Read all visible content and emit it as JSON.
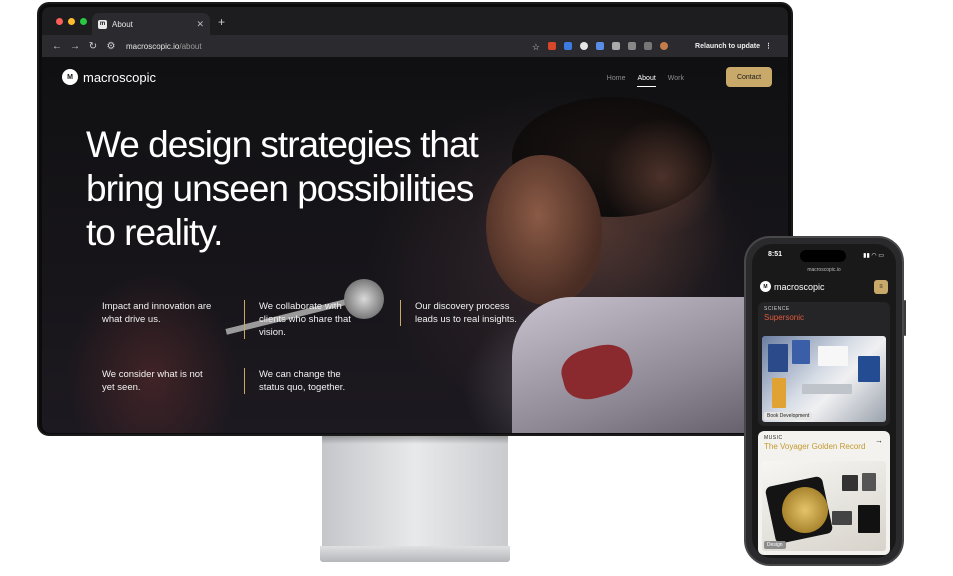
{
  "browser": {
    "tab_title": "About",
    "tab_favicon": "m",
    "url_host": "macroscopic.io",
    "url_path": "/about",
    "relaunch_label": "Relaunch to update"
  },
  "site": {
    "logo_text": "macroscopic",
    "logo_mark": "M",
    "nav": [
      "Home",
      "About",
      "Work"
    ],
    "contact_label": "Contact",
    "accent_color": "#c8a96a"
  },
  "hero": {
    "lines": [
      "We design strategies that",
      "bring unseen possibilities",
      "to reality."
    ]
  },
  "features": [
    "Impact and innovation are what drive us.",
    "We collaborate with clients who share that vision.",
    "Our discovery process leads us to real insights.",
    "We consider what is not yet seen.",
    "We can change the status quo, together."
  ],
  "phone": {
    "time": "8:51",
    "status_icons": "signal-wifi-battery",
    "url": "macroscopic.io",
    "logo_text": "macroscopic",
    "logo_mark": "M",
    "menu_icon": "menu-icon",
    "cards": [
      {
        "category": "SCIENCE",
        "title": "Supersonic",
        "title_color": "#e2583e",
        "badge": "Book Development"
      },
      {
        "category": "MUSIC",
        "title": "The Voyager Golden Record",
        "title_color": "#c49a2e",
        "badge": "Design",
        "arrow": "→"
      }
    ]
  }
}
